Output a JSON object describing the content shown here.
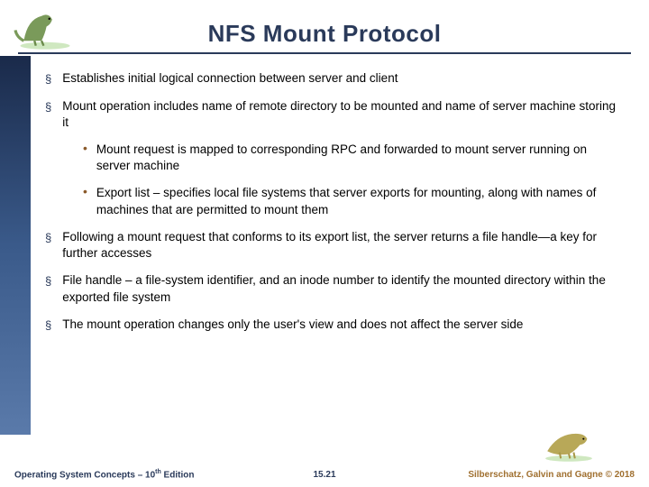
{
  "title": "NFS Mount Protocol",
  "bullets": {
    "b1": "Establishes initial logical connection between server and client",
    "b2": "Mount operation includes name of remote directory to be mounted and name of server machine storing it",
    "b2a": "Mount request is mapped to corresponding RPC and forwarded to mount server running on server machine",
    "b2b": "Export list – specifies local file systems that server exports for mounting, along with names of machines that are permitted to mount them",
    "b3": "Following a mount request that conforms to its export list, the server returns a file handle—a key for further accesses",
    "b4": "File handle – a file-system identifier, and an inode number to identify the mounted directory within the exported file system",
    "b5": "The mount operation changes only the user's view and does not affect the server side"
  },
  "footer": {
    "left_pre": "Operating System Concepts – 10",
    "left_sup": "th",
    "left_post": " Edition",
    "center": "15.21",
    "right": "Silberschatz, Galvin and Gagne © 2018"
  }
}
